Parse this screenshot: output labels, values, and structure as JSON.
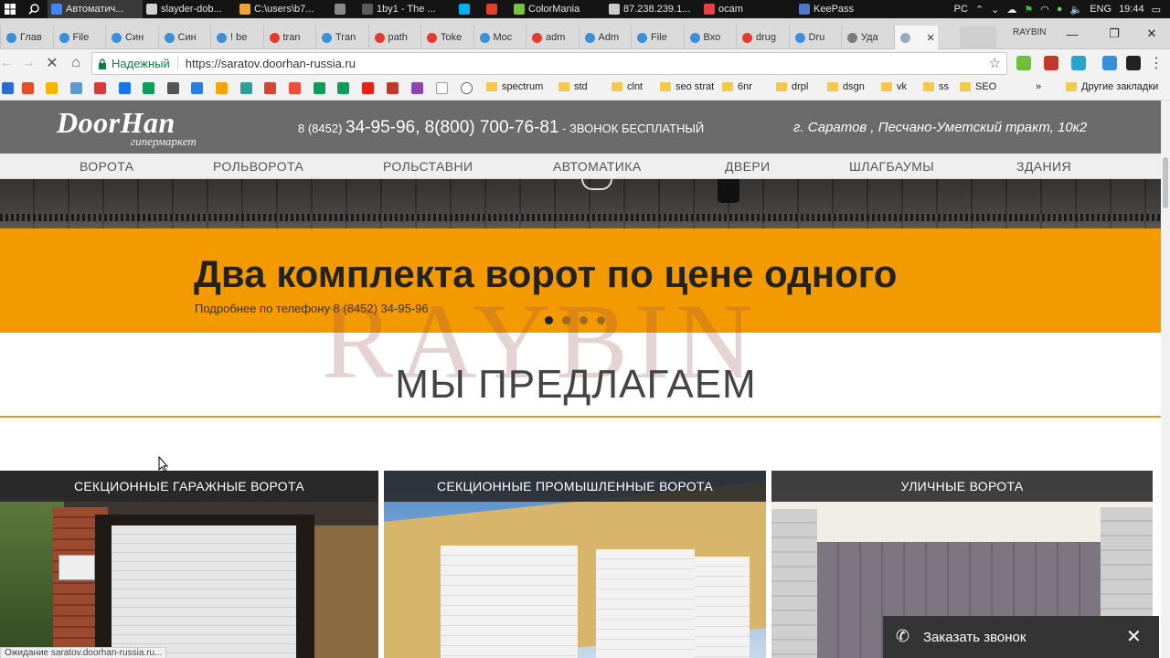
{
  "taskbar": {
    "items": [
      {
        "label": "Автоматич...",
        "color": "#4285f4"
      },
      {
        "label": "slayder-dob...",
        "color": "#d0d0d0"
      },
      {
        "label": "C:\\users\\b7...",
        "color": "#f4a13a"
      },
      {
        "label": "",
        "color": "#888888"
      },
      {
        "label": "1by1 - The ...",
        "color": "#5a5a5a"
      },
      {
        "label": "",
        "color": "#00aff0"
      },
      {
        "label": "",
        "color": "#e0402a"
      },
      {
        "label": "ColorMania",
        "color": "#7ac143"
      },
      {
        "label": "87.238.239.1...",
        "color": "#cccccc"
      },
      {
        "label": "ocam",
        "color": "#e94343"
      },
      {
        "label": "KeePass",
        "color": "#5078c8"
      }
    ],
    "tray_lang_pc": "PC",
    "tray_lang": "ENG",
    "time": "19:44"
  },
  "tabs": [
    {
      "label": "Глав",
      "icon": "site-icon"
    },
    {
      "label": "File",
      "icon": "site-icon"
    },
    {
      "label": "Син",
      "icon": "site-icon"
    },
    {
      "label": "Син",
      "icon": "site-icon"
    },
    {
      "label": "! be",
      "icon": "site-icon"
    },
    {
      "label": "tran",
      "icon": "yandex-icon"
    },
    {
      "label": "Tran",
      "icon": "site-icon"
    },
    {
      "label": "path",
      "icon": "yandex-icon"
    },
    {
      "label": "Toke",
      "icon": "yandex-icon"
    },
    {
      "label": "Moc",
      "icon": "site-icon"
    },
    {
      "label": "adm",
      "icon": "yandex-icon"
    },
    {
      "label": "Adm",
      "icon": "site-icon"
    },
    {
      "label": "File",
      "icon": "site-icon"
    },
    {
      "label": "Вхо",
      "icon": "site-icon"
    },
    {
      "label": "drug",
      "icon": "yandex-icon"
    },
    {
      "label": "Dru",
      "icon": "site-icon"
    },
    {
      "label": "Уда",
      "icon": "check-icon"
    },
    {
      "label": "",
      "icon": "loading-icon"
    }
  ],
  "profile_name": "RAYBIN",
  "address_bar": {
    "secure_label": "Надежный",
    "url": "https://saratov.doorhan-russia.ru"
  },
  "bookmarks": {
    "folders": [
      "spectrum",
      "std",
      "clnt",
      "seo strat",
      "6nr",
      "drpl",
      "dsgn",
      "vk",
      "ss",
      "SEO"
    ],
    "more": "»",
    "other": "Другие закладки"
  },
  "site": {
    "logo": "DoorHan",
    "logo_sub": "гипермаркет",
    "phone_prefix": "8 (8452)",
    "phone_main": "34-95-96, 8(800) 700-76-81",
    "phone_note": "- ЗВОНОК БЕСПЛАТНЫЙ",
    "address": "г. Саратов , Песчано-Уметский тракт, 10к2",
    "nav": [
      "ВОРОТА",
      "РОЛЬВОРОТА",
      "РОЛЬСТАВНИ",
      "АВТОМАТИКА",
      "ДВЕРИ",
      "ШЛАГБАУМЫ",
      "ЗДАНИЯ"
    ],
    "promo_title": "Два комплекта ворот по цене одного",
    "promo_sub": "Подробнее по телефону 8 (8452) 34-95-96",
    "slider_active": 1,
    "slider_count": 4,
    "watermark": "RAYBIN",
    "section_title": "МЫ ПРЕДЛАГАЕМ",
    "cards": [
      "СЕКЦИОННЫЕ ГАРАЖНЫЕ ВОРОТА",
      "СЕКЦИОННЫЕ ПРОМЫШЛЕННЫЕ ВОРОТА",
      "УЛИЧНЫЕ ВОРОТА"
    ],
    "callback_label": "Заказать звонок",
    "status_text": "Ожидание saratov.doorhan-russia.ru..."
  },
  "colors": {
    "promo": "#f39a00",
    "header": "#6b6b6b",
    "accent_line": "#d6a02a"
  }
}
